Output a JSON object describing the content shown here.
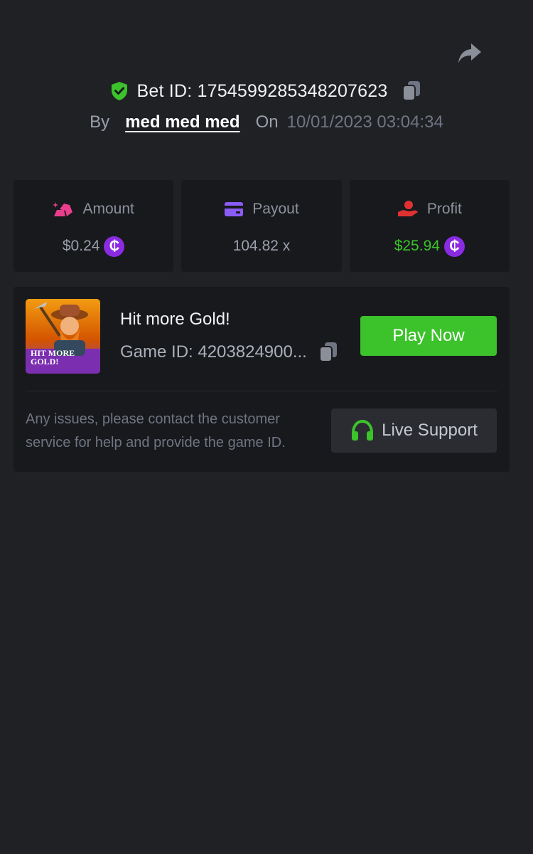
{
  "header": {
    "bet_id_label": "Bet ID: 1754599285348207623",
    "by_label": "By",
    "username": "med med med",
    "on_label": "On",
    "datetime": "10/01/2023 03:04:34"
  },
  "stats": {
    "amount": {
      "label": "Amount",
      "value": "$0.24",
      "icon": "gold-bars-icon"
    },
    "payout": {
      "label": "Payout",
      "value": "104.82 x",
      "icon": "card-icon"
    },
    "profit": {
      "label": "Profit",
      "value": "$25.94",
      "icon": "hand-coin-icon"
    },
    "coin_symbol": "₵"
  },
  "game": {
    "title": "Hit more Gold!",
    "game_id_label": "Game ID: 4203824900...",
    "thumbnail_text": [
      "HIT MORE",
      "GOLD!"
    ],
    "play_label": "Play Now"
  },
  "support": {
    "help_text": "Any issues, please contact the customer service for help and provide the game ID.",
    "button_label": "Live Support"
  },
  "colors": {
    "background": "#202125",
    "card": "#18191d",
    "accent_green": "#3cc22b",
    "coin_purple": "#8a2be2",
    "amount_pink": "#e83e8c",
    "payout_purple": "#8b5cf6",
    "profit_red": "#e03131"
  }
}
